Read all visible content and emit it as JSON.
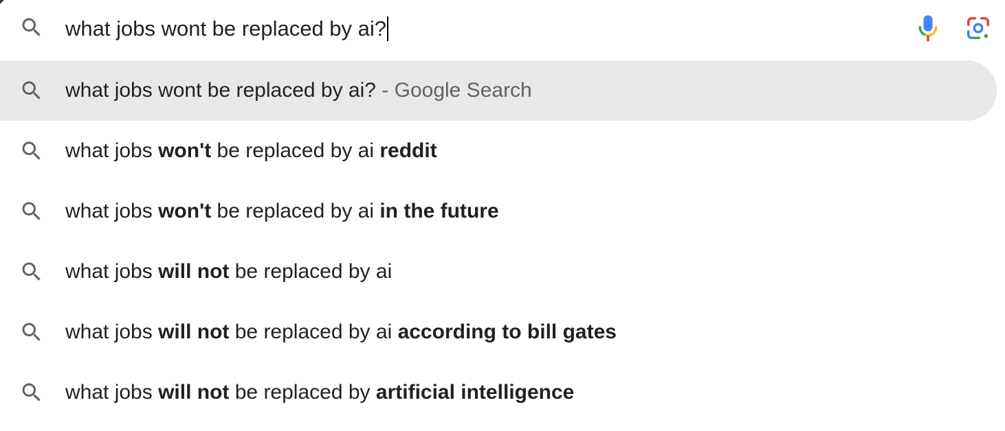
{
  "search": {
    "query": "what jobs wont be replaced by ai?"
  },
  "icons": {
    "search": "search-icon",
    "mic": "microphone-icon",
    "lens": "google-lens-icon"
  },
  "colors": {
    "highlight_bg": "#e8e8e8",
    "text": "#202124",
    "muted": "#5f6368",
    "icon_gray": "#5f6368",
    "mic_blue": "#4285f4",
    "mic_green": "#34a853",
    "mic_yellow": "#fbbc04",
    "lens_red": "#ea4335"
  },
  "suggestions": [
    {
      "parts": [
        {
          "text": "what jobs wont be replaced by ai?",
          "bold": false
        },
        {
          "text": " - Google Search",
          "bold": false,
          "muted": true
        }
      ],
      "highlighted": true
    },
    {
      "parts": [
        {
          "text": "what jobs ",
          "bold": false
        },
        {
          "text": "won't",
          "bold": true
        },
        {
          "text": " be replaced by ai ",
          "bold": false
        },
        {
          "text": "reddit",
          "bold": true
        }
      ],
      "highlighted": false
    },
    {
      "parts": [
        {
          "text": "what jobs ",
          "bold": false
        },
        {
          "text": "won't",
          "bold": true
        },
        {
          "text": " be replaced by ai ",
          "bold": false
        },
        {
          "text": "in the future",
          "bold": true
        }
      ],
      "highlighted": false
    },
    {
      "parts": [
        {
          "text": "what jobs ",
          "bold": false
        },
        {
          "text": "will not",
          "bold": true
        },
        {
          "text": " be replaced by ai",
          "bold": false
        }
      ],
      "highlighted": false
    },
    {
      "parts": [
        {
          "text": "what jobs ",
          "bold": false
        },
        {
          "text": "will not",
          "bold": true
        },
        {
          "text": " be replaced by ai ",
          "bold": false
        },
        {
          "text": "according to bill gates",
          "bold": true
        }
      ],
      "highlighted": false
    },
    {
      "parts": [
        {
          "text": "what jobs ",
          "bold": false
        },
        {
          "text": "will not",
          "bold": true
        },
        {
          "text": " be replaced by ",
          "bold": false
        },
        {
          "text": "artificial intelligence",
          "bold": true
        }
      ],
      "highlighted": false
    }
  ]
}
